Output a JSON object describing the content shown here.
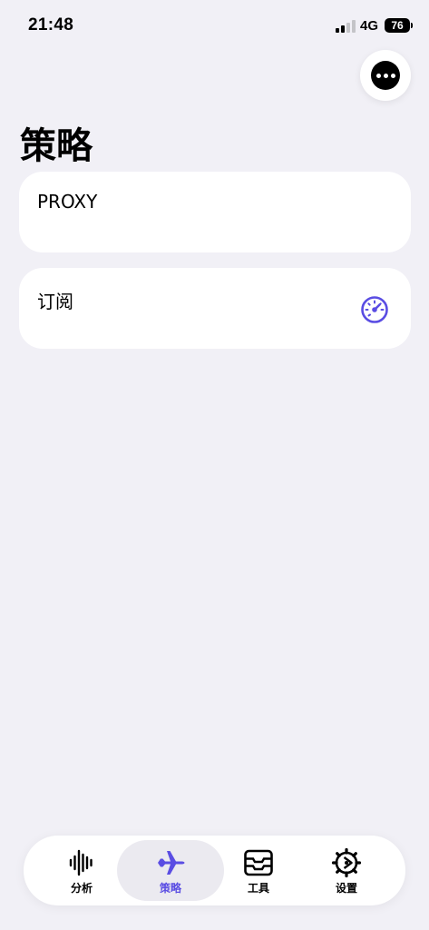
{
  "status_bar": {
    "time": "21:48",
    "network": "4G",
    "battery": "76"
  },
  "header": {
    "title": "策略",
    "more_icon": "ellipsis-circle-icon"
  },
  "cards": [
    {
      "label": "PROXY"
    },
    {
      "label": "订阅",
      "icon": "speedometer-icon"
    }
  ],
  "tab_bar": {
    "tabs": [
      {
        "label": "分析",
        "icon": "waveform-icon"
      },
      {
        "label": "策略",
        "icon": "airplane-icon",
        "active": true
      },
      {
        "label": "工具",
        "icon": "tray-icon"
      },
      {
        "label": "设置",
        "icon": "gear-icon"
      }
    ]
  },
  "colors": {
    "accent": "#5a4de3",
    "background": "#f1f0f6",
    "card": "#ffffff"
  }
}
